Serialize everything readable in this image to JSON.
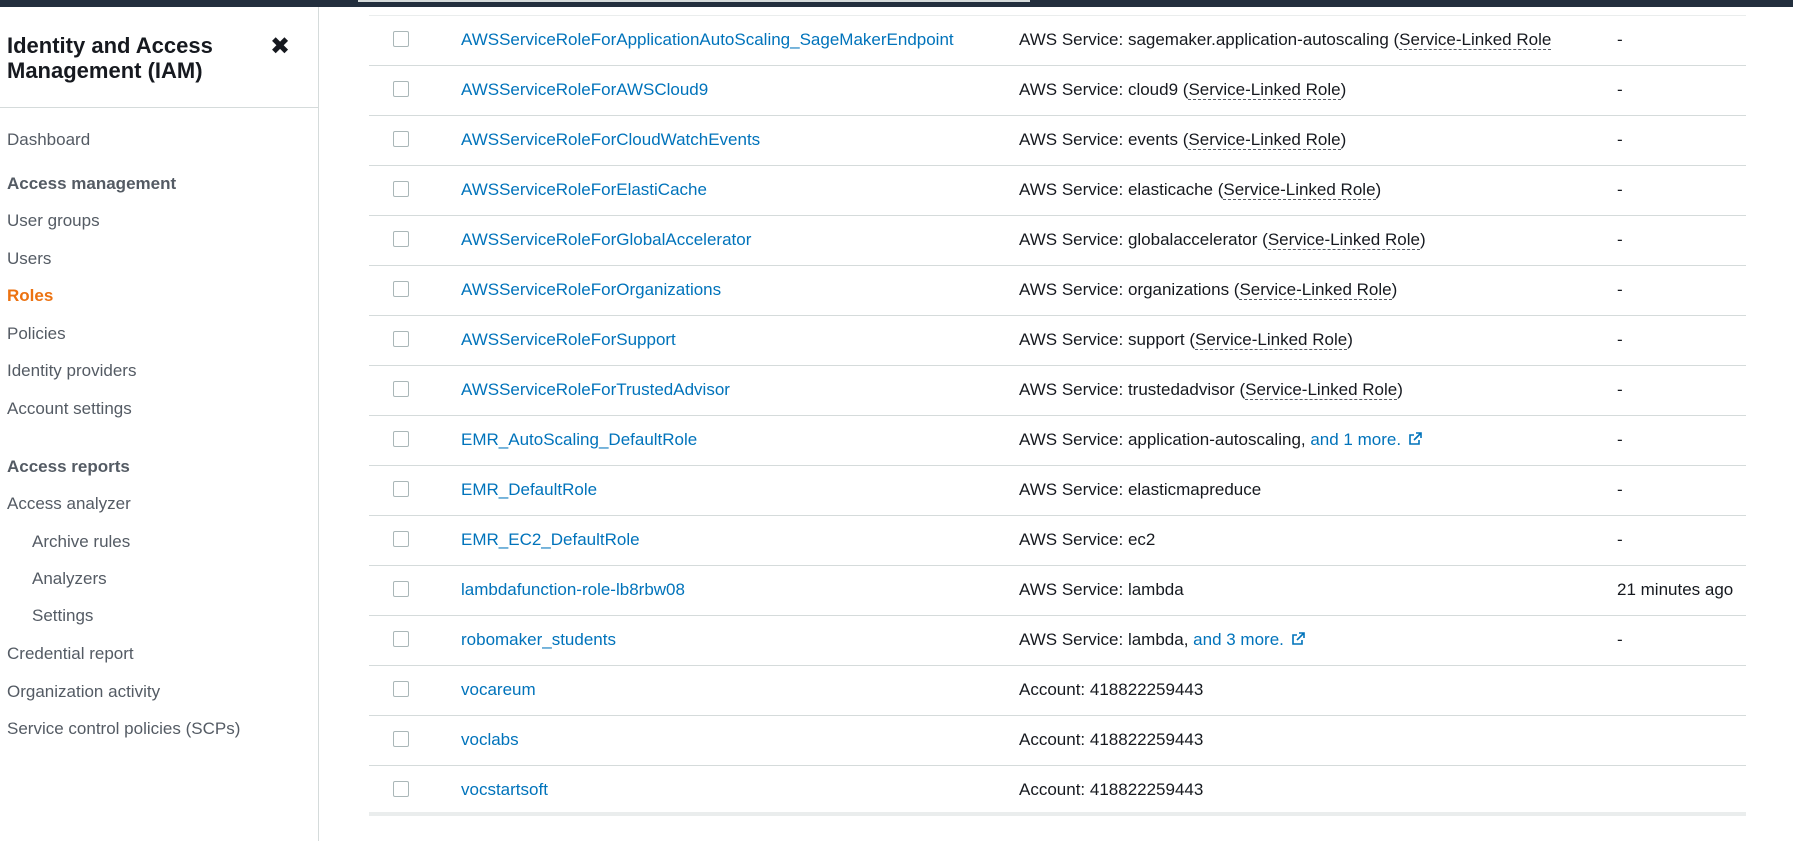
{
  "sidebar": {
    "title": "Identity and Access Management (IAM)",
    "close_glyph": "✖",
    "dashboard": "Dashboard",
    "access_management": {
      "heading": "Access management",
      "items": [
        "User groups",
        "Users",
        "Roles",
        "Policies",
        "Identity providers",
        "Account settings"
      ],
      "active": "Roles"
    },
    "access_reports": {
      "heading": "Access reports",
      "items": [
        "Access analyzer",
        "Archive rules",
        "Analyzers",
        "Settings",
        "Credential report",
        "Organization activity",
        "Service control policies (SCPs)"
      ]
    }
  },
  "colors": {
    "link": "#0073bb",
    "active_nav": "#ec7211",
    "topbar": "#232f3e"
  },
  "roles_table": {
    "rows": [
      {
        "name": "AWSServiceRoleForApplicationAutoScaling_SageMakerEndpoint",
        "entity_prefix": "AWS Service: sagemaker.application-autoscaling (",
        "entity_slr": "Service-Linked Role",
        "entity_suffix": "",
        "more": "",
        "last_activity": "-"
      },
      {
        "name": "AWSServiceRoleForAWSCloud9",
        "entity_prefix": "AWS Service: cloud9 (",
        "entity_slr": "Service-Linked Role",
        "entity_suffix": ")",
        "more": "",
        "last_activity": "-"
      },
      {
        "name": "AWSServiceRoleForCloudWatchEvents",
        "entity_prefix": "AWS Service: events (",
        "entity_slr": "Service-Linked Role",
        "entity_suffix": ")",
        "more": "",
        "last_activity": "-"
      },
      {
        "name": "AWSServiceRoleForElastiCache",
        "entity_prefix": "AWS Service: elasticache (",
        "entity_slr": "Service-Linked Role",
        "entity_suffix": ")",
        "more": "",
        "last_activity": "-"
      },
      {
        "name": "AWSServiceRoleForGlobalAccelerator",
        "entity_prefix": "AWS Service: globalaccelerator (",
        "entity_slr": "Service-Linked Role",
        "entity_suffix": ")",
        "more": "",
        "last_activity": "-"
      },
      {
        "name": "AWSServiceRoleForOrganizations",
        "entity_prefix": "AWS Service: organizations (",
        "entity_slr": "Service-Linked Role",
        "entity_suffix": ")",
        "more": "",
        "last_activity": "-"
      },
      {
        "name": "AWSServiceRoleForSupport",
        "entity_prefix": "AWS Service: support (",
        "entity_slr": "Service-Linked Role",
        "entity_suffix": ")",
        "more": "",
        "last_activity": "-"
      },
      {
        "name": "AWSServiceRoleForTrustedAdvisor",
        "entity_prefix": "AWS Service: trustedadvisor (",
        "entity_slr": "Service-Linked Role",
        "entity_suffix": ")",
        "more": "",
        "last_activity": "-"
      },
      {
        "name": "EMR_AutoScaling_DefaultRole",
        "entity_prefix": "AWS Service: application-autoscaling, ",
        "entity_slr": "",
        "entity_suffix": "",
        "more": "and 1 more.",
        "last_activity": "-"
      },
      {
        "name": "EMR_DefaultRole",
        "entity_prefix": "AWS Service: elasticmapreduce",
        "entity_slr": "",
        "entity_suffix": "",
        "more": "",
        "last_activity": "-"
      },
      {
        "name": "EMR_EC2_DefaultRole",
        "entity_prefix": "AWS Service: ec2",
        "entity_slr": "",
        "entity_suffix": "",
        "more": "",
        "last_activity": "-"
      },
      {
        "name": "lambdafunction-role-lb8rbw08",
        "entity_prefix": "AWS Service: lambda",
        "entity_slr": "",
        "entity_suffix": "",
        "more": "",
        "last_activity": "21 minutes ago"
      },
      {
        "name": "robomaker_students",
        "entity_prefix": "AWS Service: lambda, ",
        "entity_slr": "",
        "entity_suffix": "",
        "more": "and 3 more.",
        "last_activity": "-"
      },
      {
        "name": "vocareum",
        "entity_prefix": "Account: 418822259443",
        "entity_slr": "",
        "entity_suffix": "",
        "more": "",
        "last_activity": ""
      },
      {
        "name": "voclabs",
        "entity_prefix": "Account: 418822259443",
        "entity_slr": "",
        "entity_suffix": "",
        "more": "",
        "last_activity": ""
      },
      {
        "name": "vocstartsoft",
        "entity_prefix": "Account: 418822259443",
        "entity_slr": "",
        "entity_suffix": "",
        "more": "",
        "last_activity": ""
      }
    ]
  },
  "icons": {
    "close": "close-icon",
    "external_link": "external-link-icon"
  }
}
